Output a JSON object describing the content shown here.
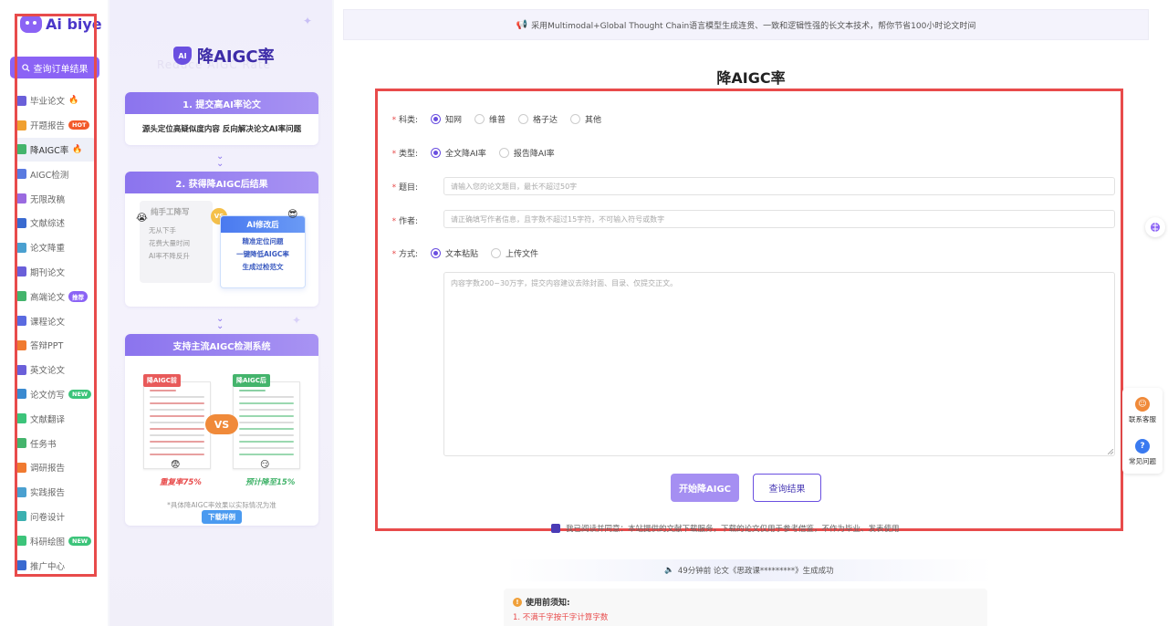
{
  "brand": {
    "name": "Ai biye"
  },
  "sidebar": {
    "order_button": "查询订单结果",
    "items": [
      {
        "label": "毕业论文",
        "icon": "graduation-cap-icon",
        "color": "#6a5fd9",
        "badge": "",
        "fire": true
      },
      {
        "label": "开题报告",
        "icon": "report-icon",
        "color": "#f0a030",
        "badge": "HOT",
        "badge_color": "#f25a2a",
        "fire": false
      },
      {
        "label": "降AIGC率",
        "icon": "reduce-aigc-icon",
        "color": "#44b46c",
        "badge": "",
        "fire": true,
        "active": true
      },
      {
        "label": "AIGC检测",
        "icon": "detect-icon",
        "color": "#5a7ae0",
        "badge": "",
        "fire": false
      },
      {
        "label": "无限改稿",
        "icon": "edit-icon",
        "color": "#9a6ae0",
        "badge": "",
        "fire": false
      },
      {
        "label": "文献综述",
        "icon": "book-icon",
        "color": "#3a6ad0",
        "badge": "",
        "fire": false
      },
      {
        "label": "论文降重",
        "icon": "chart-icon",
        "color": "#4aa0d0",
        "badge": "",
        "fire": false
      },
      {
        "label": "期刊论文",
        "icon": "journal-icon",
        "color": "#6a5fd9",
        "badge": "",
        "fire": false
      },
      {
        "label": "高端论文",
        "icon": "premium-icon",
        "color": "#44b46c",
        "badge": "推荐",
        "badge_color": "#8b63f5",
        "fire": false
      },
      {
        "label": "课程论文",
        "icon": "course-icon",
        "color": "#5a6ae0",
        "badge": "",
        "fire": false
      },
      {
        "label": "答辩PPT",
        "icon": "ppt-icon",
        "color": "#f07a30",
        "badge": "",
        "fire": false
      },
      {
        "label": "英文论文",
        "icon": "english-icon",
        "color": "#6a5fd9",
        "badge": "",
        "fire": false
      },
      {
        "label": "论文仿写",
        "icon": "rewrite-icon",
        "color": "#3a8ad0",
        "badge": "NEW",
        "badge_color": "#3cc47a",
        "fire": false
      },
      {
        "label": "文献翻译",
        "icon": "translate-icon",
        "color": "#3cc47a",
        "badge": "",
        "fire": false
      },
      {
        "label": "任务书",
        "icon": "task-icon",
        "color": "#44b46c",
        "badge": "",
        "fire": false
      },
      {
        "label": "调研报告",
        "icon": "survey-icon",
        "color": "#f07a30",
        "badge": "",
        "fire": false
      },
      {
        "label": "实践报告",
        "icon": "practice-icon",
        "color": "#4aa0d0",
        "badge": "",
        "fire": false
      },
      {
        "label": "问卷设计",
        "icon": "questionnaire-icon",
        "color": "#3cb0b0",
        "badge": "",
        "fire": false
      },
      {
        "label": "科研绘图",
        "icon": "drawing-icon",
        "color": "#3cc47a",
        "badge": "NEW",
        "badge_color": "#3cc47a",
        "fire": false
      },
      {
        "label": "推广中心",
        "icon": "promote-icon",
        "color": "#3a6ad0",
        "badge": "",
        "fire": false
      }
    ]
  },
  "promo": {
    "title": "降AIGC率",
    "watermark": "Reduce AIGC Rate",
    "step1": {
      "head": "1. 提交高AI率论文",
      "text": "源头定位高疑似度内容 反向解决论文AI率问题"
    },
    "step2": {
      "head": "2. 获得降AIGC后结果",
      "manual_title": "纯手工降写",
      "manual_lines": [
        "无从下手",
        "花费大量时间",
        "AI率不降反升"
      ],
      "vs": "VS",
      "ai_title": "AI修改后",
      "ai_lines": [
        "精准定位问题",
        "一键降低AIGC率",
        "生成过检范文"
      ]
    },
    "step3": {
      "head": "支持主流AIGC检测系统",
      "before_tag": "降AIGC前",
      "after_tag": "降AIGC后",
      "vs": "VS",
      "before_rate": "重复率75%",
      "after_rate": "预计降至15%",
      "note": "*具体降AIGC率效果以实际情况为准",
      "sample_button": "下载样例"
    }
  },
  "main": {
    "notice": "采用Multimodal+Global Thought Chain语言模型生成连贯、一致和逻辑性强的长文本技术，帮你节省100小时论文时间",
    "title": "降AIGC率",
    "subject": {
      "label": "科类:",
      "options": [
        "知网",
        "维普",
        "格子达",
        "其他"
      ],
      "selected": "知网"
    },
    "type": {
      "label": "类型:",
      "options": [
        "全文降AI率",
        "报告降AI率"
      ],
      "selected": "全文降AI率"
    },
    "topic": {
      "label": "题目:",
      "placeholder": "请输入您的论文题目，最长不超过50字"
    },
    "author": {
      "label": "作者:",
      "placeholder": "请正确填写作者信息，且字数不超过15字符，不可输入符号或数字"
    },
    "method": {
      "label": "方式:",
      "options": [
        "文本粘贴",
        "上传文件"
      ],
      "selected": "文本粘贴"
    },
    "content": {
      "placeholder": "内容字数200~30万字，提交内容建议去除封面、目录、仅提交正文。"
    },
    "start_button": "开始降AIGC",
    "query_button": "查询结果",
    "agreement": "我已阅读并同意：本站提供的文献下载服务，下载的论文仅用于参考借鉴，不作为毕业、发表使用",
    "success": "49分钟前 论文《思政课*********》生成成功",
    "usage_title": "使用前须知:",
    "usage_item1": "1. 不满千字按千字计算字数"
  },
  "float": {
    "service": "联系客服",
    "faq": "常见问题"
  },
  "colors": {
    "accent": "#6a4fe0",
    "accent_light": "#8b63f5",
    "highlight_frame": "#e84b4b"
  }
}
